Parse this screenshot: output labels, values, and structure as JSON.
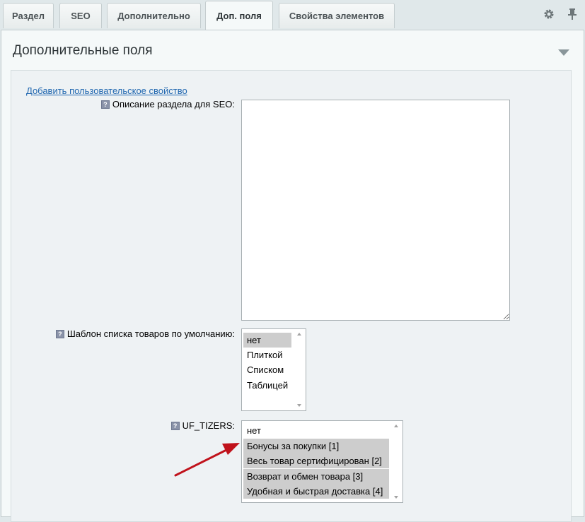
{
  "tabs": [
    {
      "label": "Раздел"
    },
    {
      "label": "SEO"
    },
    {
      "label": "Дополнительно"
    },
    {
      "label": "Доп. поля"
    },
    {
      "label": "Свойства элементов"
    }
  ],
  "toolbar_icons": {
    "settings": "gear-icon",
    "pin": "pin-icon"
  },
  "section": {
    "title": "Дополнительные поля",
    "add_link": "Добавить пользовательское свойство"
  },
  "fields": {
    "seo_description": {
      "label": "Описание раздела для SEO:",
      "value": ""
    },
    "template": {
      "label": "Шаблон списка товаров по умолчанию:",
      "options": [
        "нет",
        "Плиткой",
        "Списком",
        "Таблицей"
      ],
      "selected": "нет"
    },
    "tizers": {
      "label": "UF_TIZERS:",
      "options": [
        "нет",
        "Бонусы за покупки [1]",
        "Весь товар сертифицирован [2]",
        "Возврат и обмен товара [3]",
        "Удобная и быстрая доставка [4]"
      ],
      "selected": [
        "Бонусы за покупки [1]",
        "Весь товар сертифицирован [2]",
        "Возврат и обмен товара [3]",
        "Удобная и быстрая доставка [4]"
      ]
    }
  },
  "help_icon_glyph": "?",
  "colors": {
    "annotation_arrow": "#c0121b",
    "link": "#2067b0",
    "selected_option": "#cdcdcd"
  }
}
